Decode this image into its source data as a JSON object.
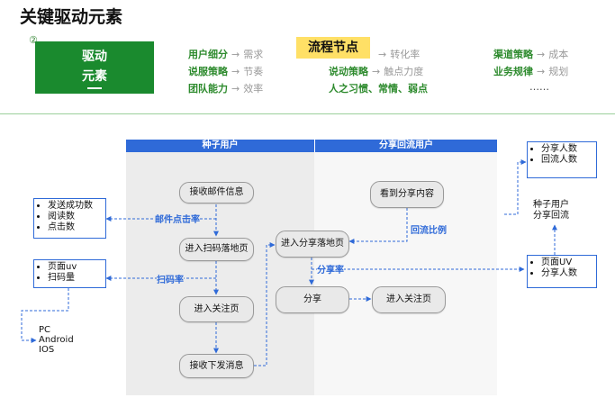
{
  "header": {
    "title": "关键驱动元素",
    "badge": "②",
    "drive_line1": "驱动",
    "drive_line2": "元素"
  },
  "factors": {
    "col1": [
      {
        "key": "用户细分",
        "value": "需求"
      },
      {
        "key": "说服策略",
        "value": "节奏"
      },
      {
        "key": "团队能力",
        "value": "效率"
      }
    ],
    "col2_highlight": "流程节点",
    "col2": [
      {
        "key": "",
        "value": "转化率"
      },
      {
        "key": "说动策略",
        "value": "触点力度"
      }
    ],
    "col2_extra": "人之习惯、常情、弱点",
    "col3": [
      {
        "key": "渠道策略",
        "value": "成本"
      },
      {
        "key": "业务规律",
        "value": "规划"
      }
    ],
    "col3_more": "……",
    "arrow": "→"
  },
  "diagram": {
    "headers": {
      "left": "种子用户",
      "right": "分享回流用户"
    },
    "nodes": {
      "receive_email": "接收邮件信息",
      "scan_landing": "进入扫码落地页",
      "follow_page": "进入关注页",
      "receive_msg": "接收下发消息",
      "see_share": "看到分享内容",
      "share_landing": "进入分享落地页",
      "share": "分享",
      "follow_page2": "进入关注页"
    },
    "labels": {
      "email_ctr": "邮件点击率",
      "scan_rate": "扫码率",
      "return_ratio": "回流比例",
      "share_rate": "分享率"
    },
    "metric_boxes": {
      "email": [
        "发送成功数",
        "阅读数",
        "点击数"
      ],
      "scan": [
        "页面uv",
        "扫码量"
      ],
      "share_top": [
        "分享人数",
        "回流人数"
      ],
      "share_bottom": [
        "页面UV",
        "分享人数"
      ]
    },
    "platforms": [
      "PC",
      "Android",
      "IOS"
    ],
    "seed_return": [
      "种子用户",
      "分享回流"
    ]
  },
  "colors": {
    "brand_green": "#1a8a2e",
    "accent_blue": "#2f6ad8",
    "highlight_yellow": "#ffe066"
  }
}
